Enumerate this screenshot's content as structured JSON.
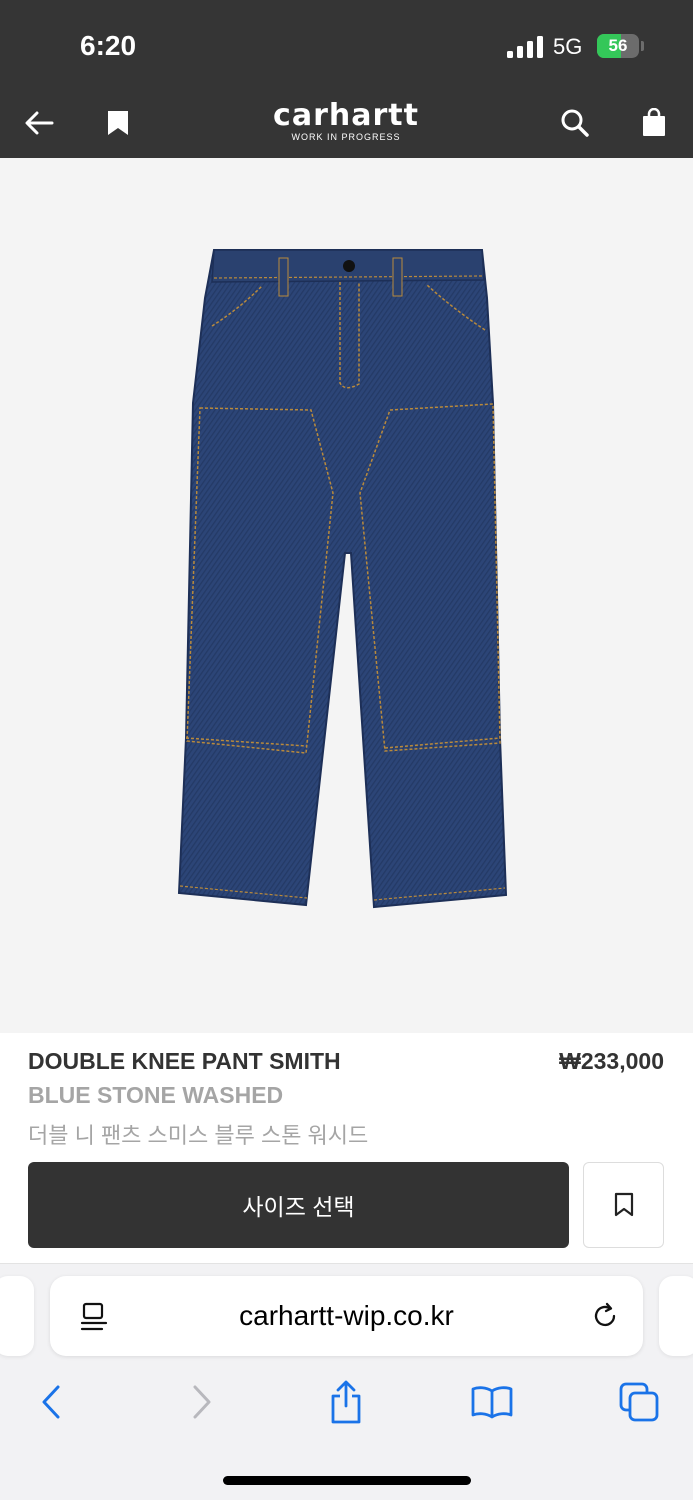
{
  "status_bar": {
    "time": "6:20",
    "network": "5G",
    "battery": "56",
    "battery_level": 0.56
  },
  "nav": {
    "brand_name": "carhartt",
    "brand_sub": "WORK IN PROGRESS",
    "icons": [
      "back-arrow-icon",
      "bookmark-icon",
      "search-icon",
      "shopping-bag-icon"
    ]
  },
  "product": {
    "name": "DOUBLE KNEE PANT SMITH",
    "price": "₩233,000",
    "color": "BLUE STONE WASHED",
    "korean_name": "더블 니 팬츠 스미스 블루 스톤 워시드",
    "size_button": "사이즈 선택",
    "denim_color": "#2c4577"
  },
  "browser": {
    "url": "carhartt-wip.co.kr",
    "accent": "#1a73e8",
    "toolbar": [
      "back",
      "forward",
      "share",
      "bookmarks",
      "tabs"
    ]
  }
}
